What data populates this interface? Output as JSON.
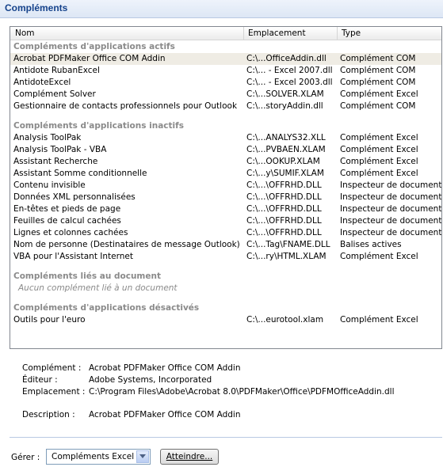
{
  "header": {
    "title": "Compléments"
  },
  "columns": {
    "name": "Nom",
    "location": "Emplacement",
    "type": "Type"
  },
  "groups": {
    "active": {
      "label": "Compléments d'applications actifs",
      "items": [
        {
          "name": "Acrobat PDFMaker Office COM Addin",
          "location": "C:\\...OfficeAddin.dll",
          "type": "Complément COM"
        },
        {
          "name": "Antidote RubanExcel",
          "location": "C:\\... - Excel 2007.dll",
          "type": "Complément COM"
        },
        {
          "name": "AntidoteExcel",
          "location": "C:\\... - Excel 2003.dll",
          "type": "Complément COM"
        },
        {
          "name": "Complément Solver",
          "location": "C:\\...SOLVER.XLAM",
          "type": "Complément Excel"
        },
        {
          "name": "Gestionnaire de contacts professionnels pour Outlook",
          "location": "C:\\...storyAddin.dll",
          "type": "Complément COM"
        }
      ]
    },
    "inactive": {
      "label": "Compléments d'applications inactifs",
      "items": [
        {
          "name": "Analysis ToolPak",
          "location": "C:\\...ANALYS32.XLL",
          "type": "Complément Excel"
        },
        {
          "name": "Analysis ToolPak - VBA",
          "location": "C:\\...PVBAEN.XLAM",
          "type": "Complément Excel"
        },
        {
          "name": "Assistant Recherche",
          "location": "C:\\...OOKUP.XLAM",
          "type": "Complément Excel"
        },
        {
          "name": "Assistant Somme conditionnelle",
          "location": "C:\\...y\\SUMIF.XLAM",
          "type": "Complément Excel"
        },
        {
          "name": "Contenu invisible",
          "location": "C:\\...\\OFFRHD.DLL",
          "type": "Inspecteur de document"
        },
        {
          "name": "Données XML personnalisées",
          "location": "C:\\...\\OFFRHD.DLL",
          "type": "Inspecteur de document"
        },
        {
          "name": "En-têtes et pieds de page",
          "location": "C:\\...\\OFFRHD.DLL",
          "type": "Inspecteur de document"
        },
        {
          "name": "Feuilles de calcul cachées",
          "location": "C:\\...\\OFFRHD.DLL",
          "type": "Inspecteur de document"
        },
        {
          "name": "Lignes et colonnes cachées",
          "location": "C:\\...\\OFFRHD.DLL",
          "type": "Inspecteur de document"
        },
        {
          "name": "Nom de personne (Destinataires de message Outlook)",
          "location": "C:\\...Tag\\FNAME.DLL",
          "type": "Balises actives"
        },
        {
          "name": "VBA pour l'Assistant Internet",
          "location": "C:\\...ry\\HTML.XLAM",
          "type": "Complément Excel"
        }
      ]
    },
    "document": {
      "label": "Compléments liés au document",
      "empty": "Aucun complément lié à un document"
    },
    "disabled": {
      "label": "Compléments d'applications désactivés",
      "items": [
        {
          "name": "Outils pour l'euro",
          "location": "C:\\...eurotool.xlam",
          "type": "Complément Excel"
        }
      ]
    }
  },
  "details": {
    "addin_label": "Complément :",
    "addin_value": "Acrobat PDFMaker Office COM Addin",
    "publisher_label": "Éditeur :",
    "publisher_value": "Adobe Systems, Incorporated",
    "location_label": "Emplacement :",
    "location_value": "C:\\Program Files\\Adobe\\Acrobat 8.0\\PDFMaker\\Office\\PDFMOfficeAddin.dll",
    "description_label": "Description :",
    "description_value": "Acrobat PDFMaker Office COM Addin"
  },
  "manage": {
    "label": "Gérer :",
    "selected": "Compléments Excel",
    "go_button": "Atteindre..."
  },
  "colors": {
    "header_text": "#15428b",
    "group_text": "#8a8a8a",
    "selected_row": "#efece4"
  }
}
